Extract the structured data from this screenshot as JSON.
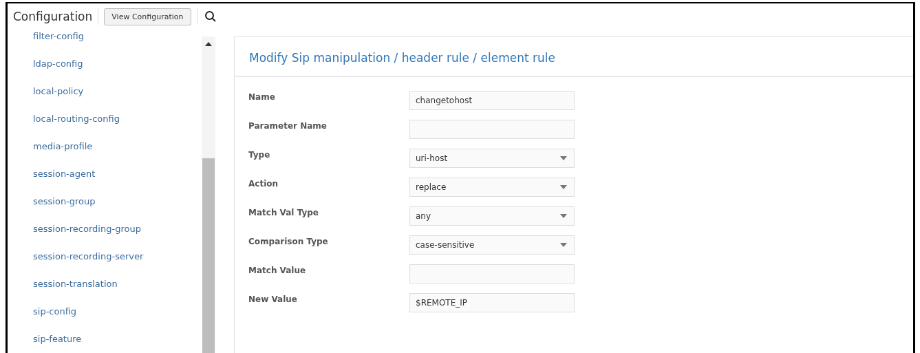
{
  "header": {
    "title": "Configuration",
    "view_button": "View Configuration"
  },
  "sidebar": {
    "items": [
      {
        "label": "filter-config"
      },
      {
        "label": "ldap-config"
      },
      {
        "label": "local-policy"
      },
      {
        "label": "local-routing-config"
      },
      {
        "label": "media-profile"
      },
      {
        "label": "session-agent"
      },
      {
        "label": "session-group"
      },
      {
        "label": "session-recording-group"
      },
      {
        "label": "session-recording-server"
      },
      {
        "label": "session-translation"
      },
      {
        "label": "sip-config"
      },
      {
        "label": "sip-feature"
      }
    ]
  },
  "form": {
    "title": "Modify Sip manipulation / header rule / element rule",
    "fields": [
      {
        "label": "Name",
        "kind": "text",
        "value": "changetohost"
      },
      {
        "label": "Parameter Name",
        "kind": "text"
      },
      {
        "label": "Type",
        "kind": "select",
        "value": "uri-host"
      },
      {
        "label": "Action",
        "kind": "select",
        "value": "replace"
      },
      {
        "label": "Match Val Type",
        "kind": "select",
        "value": "any"
      },
      {
        "label": "Comparison Type",
        "kind": "select",
        "value": "case-sensitive"
      },
      {
        "label": "Match Value",
        "kind": "text"
      },
      {
        "label": "New Value",
        "kind": "text",
        "value": "$REMOTE_IP"
      }
    ]
  }
}
